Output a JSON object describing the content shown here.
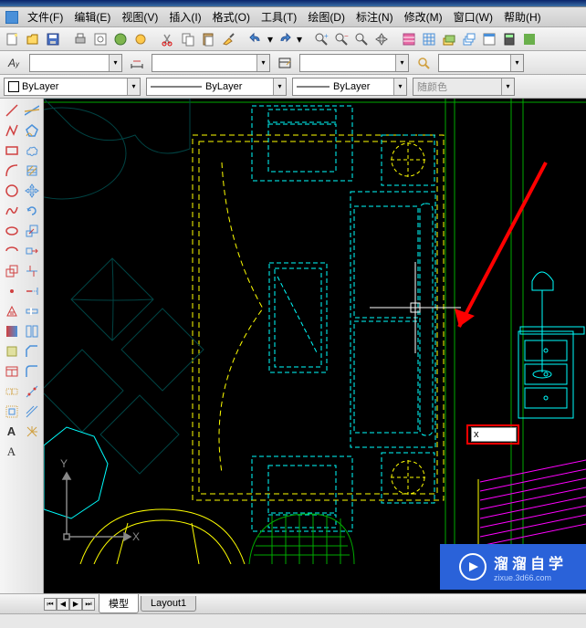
{
  "menu": {
    "file": "文件(F)",
    "edit": "编辑(E)",
    "view": "视图(V)",
    "insert": "插入(I)",
    "format": "格式(O)",
    "tools": "工具(T)",
    "draw": "绘图(D)",
    "annotate": "标注(N)",
    "modify": "修改(M)",
    "window": "窗口(W)",
    "help": "帮助(H)"
  },
  "props": {
    "text_style_empty": "",
    "bylayer": "ByLayer",
    "linetype": "ByLayer",
    "lineweight": "ByLayer",
    "color": "随颜色"
  },
  "cmd": {
    "value": "x"
  },
  "ucs": {
    "x": "X",
    "y": "Y"
  },
  "tabs": {
    "model": "模型",
    "layout1": "Layout1"
  },
  "watermark": {
    "cn": "溜溜自学",
    "en": "zixue.3d66.com"
  }
}
